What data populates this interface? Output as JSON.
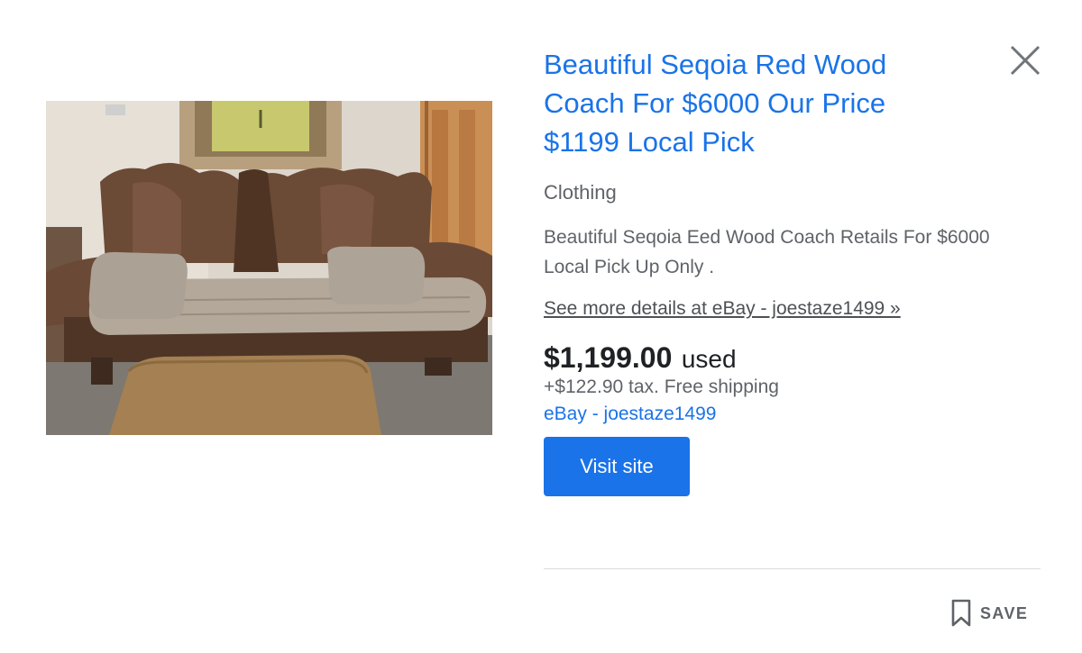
{
  "listing": {
    "title": "Beautiful Seqoia Red Wood Coach For $6000 Our Price $1199 Local Pick",
    "category": "Clothing",
    "description": "Beautiful Seqoia Eed Wood Coach Retails For $6000 Local Pick Up Only .",
    "more_details_link": "See more details at eBay - joestaze1499 »",
    "price": "$1,199.00",
    "condition": "used",
    "tax_shipping": "+$122.90 tax. Free shipping",
    "seller": "eBay - joestaze1499"
  },
  "actions": {
    "visit_site_label": "Visit site",
    "save_label": "SAVE"
  },
  "icons": {
    "close": "close-icon",
    "bookmark": "bookmark-icon"
  },
  "colors": {
    "link_blue": "#1a73e8",
    "button_blue": "#1a73e8",
    "text_gray": "#5f6368",
    "text_dark": "#202124"
  }
}
